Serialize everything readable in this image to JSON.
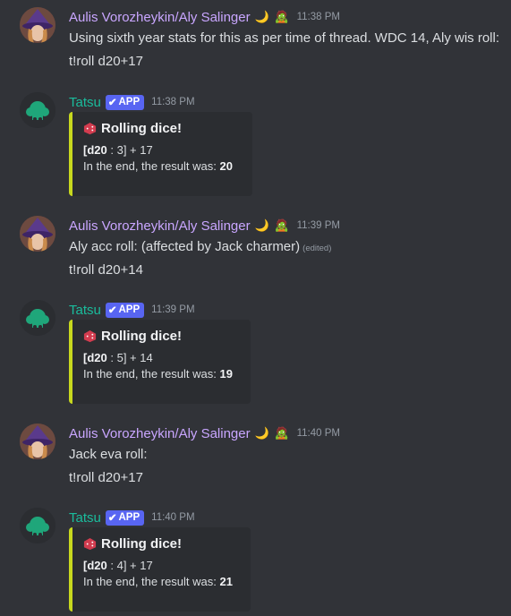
{
  "messages": [
    {
      "type": "user",
      "author": "Aulis Vorozheykin/Aly Salinger",
      "emoji1": "🌙",
      "emoji2": "🧟",
      "timestamp": "11:38 PM",
      "line1": "Using sixth year stats for this as per time of thread. WDC 14, Aly wis roll:",
      "line2": "t!roll d20+17"
    },
    {
      "type": "bot",
      "author": "Tatsu",
      "badge": "APP",
      "timestamp": "11:38 PM",
      "embed": {
        "title": "Rolling dice!",
        "roll_die": "d20",
        "roll_rest": " : 3] + 17",
        "result_prefix": "In the end, the result was: ",
        "result": "20"
      }
    },
    {
      "type": "user",
      "author": "Aulis Vorozheykin/Aly Salinger",
      "emoji1": "🌙",
      "emoji2": "🧟",
      "timestamp": "11:39 PM",
      "line1": "Aly acc roll: (affected by Jack charmer)",
      "edited": "(edited)",
      "line2": "t!roll d20+14"
    },
    {
      "type": "bot",
      "author": "Tatsu",
      "badge": "APP",
      "timestamp": "11:39 PM",
      "embed": {
        "title": "Rolling dice!",
        "roll_die": "d20",
        "roll_rest": " : 5] + 14",
        "result_prefix": "In the end, the result was: ",
        "result": "19"
      }
    },
    {
      "type": "user",
      "author": "Aulis Vorozheykin/Aly Salinger",
      "emoji1": "🌙",
      "emoji2": "🧟",
      "timestamp": "11:40 PM",
      "line1": "Jack eva roll:",
      "line2": "t!roll d20+17"
    },
    {
      "type": "bot",
      "author": "Tatsu",
      "badge": "APP",
      "timestamp": "11:40 PM",
      "embed": {
        "title": "Rolling dice!",
        "roll_die": "d20",
        "roll_rest": " : 4] + 17",
        "result_prefix": "In the end, the result was: ",
        "result": "21"
      }
    }
  ],
  "colors": {
    "background": "#313338",
    "username": "#c9a6ff",
    "bot_name": "#1abc9c",
    "app_badge": "#5865f2",
    "embed_bar": "#c7d81e",
    "embed_bg": "#2b2d31"
  }
}
